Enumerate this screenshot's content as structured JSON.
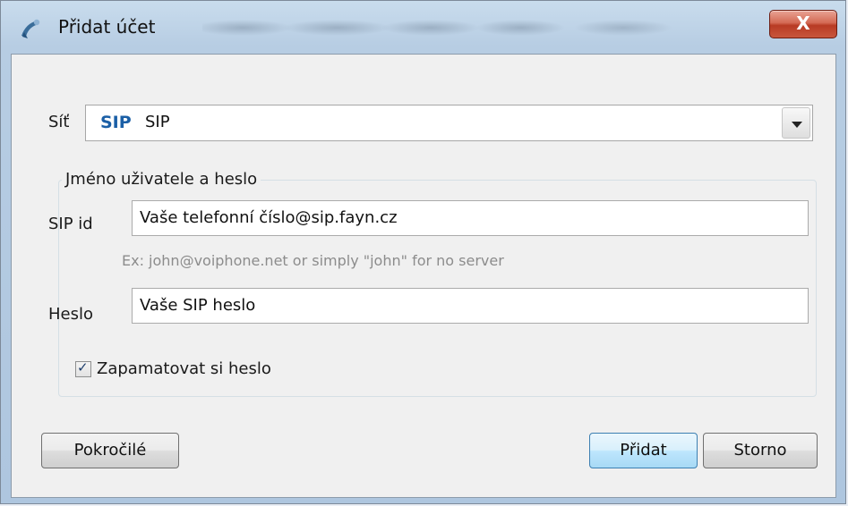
{
  "window": {
    "title": "Přidat účet",
    "close_label": "X"
  },
  "network": {
    "label": "Síť",
    "badge": "SIP",
    "selected": "SIP"
  },
  "credentials": {
    "group_title": "Jméno uživatele a heslo",
    "sip_id_label": "SIP id",
    "sip_id_value": "Vaše telefonní číslo@sip.fayn.cz",
    "hint": "Ex: john@voiphone.net or simply \"john\" for no server",
    "password_label": "Heslo",
    "password_value": "Vaše SIP heslo",
    "remember_label": "Zapamatovat si heslo",
    "remember_checked": true
  },
  "buttons": {
    "advanced": "Pokročilé",
    "add": "Přidat",
    "cancel": "Storno"
  }
}
